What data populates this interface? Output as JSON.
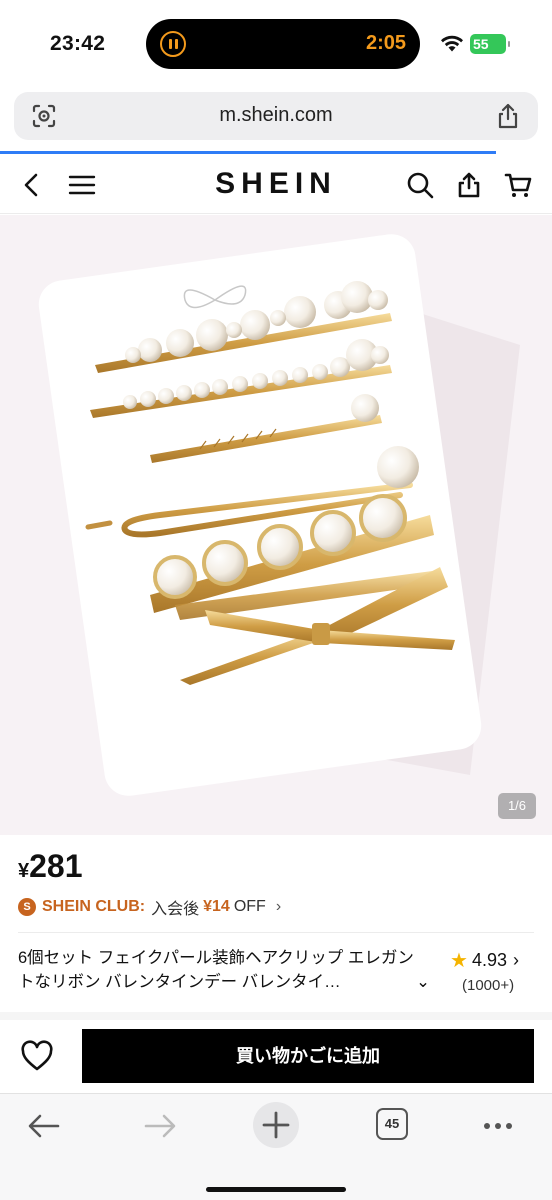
{
  "status_bar": {
    "time": "23:42",
    "island_time": "2:05",
    "battery": "55"
  },
  "browser": {
    "url": "m.shein.com",
    "tab_count": "45"
  },
  "site": {
    "logo": "SHEIN"
  },
  "product": {
    "image_counter": "1/6",
    "currency": "¥",
    "price": "281",
    "club": {
      "badge": "S",
      "name": "SHEIN CLUB:",
      "prefix": "入会後",
      "discount": "¥14",
      "suffix": "OFF"
    },
    "title": "6個セット フェイクパール装飾ヘアクリップ エレガントなリボン バレンタインデー バレンタイ…",
    "rating": "4.93",
    "review_count": "(1000+)"
  },
  "actions": {
    "add_to_cart": "買い物かごに追加"
  },
  "colors": {
    "accent_orange": "#c7641f",
    "island_orange": "#f39a1c",
    "battery_green": "#34c759",
    "progress_blue": "#2f7cf6",
    "star": "#f5b400"
  }
}
